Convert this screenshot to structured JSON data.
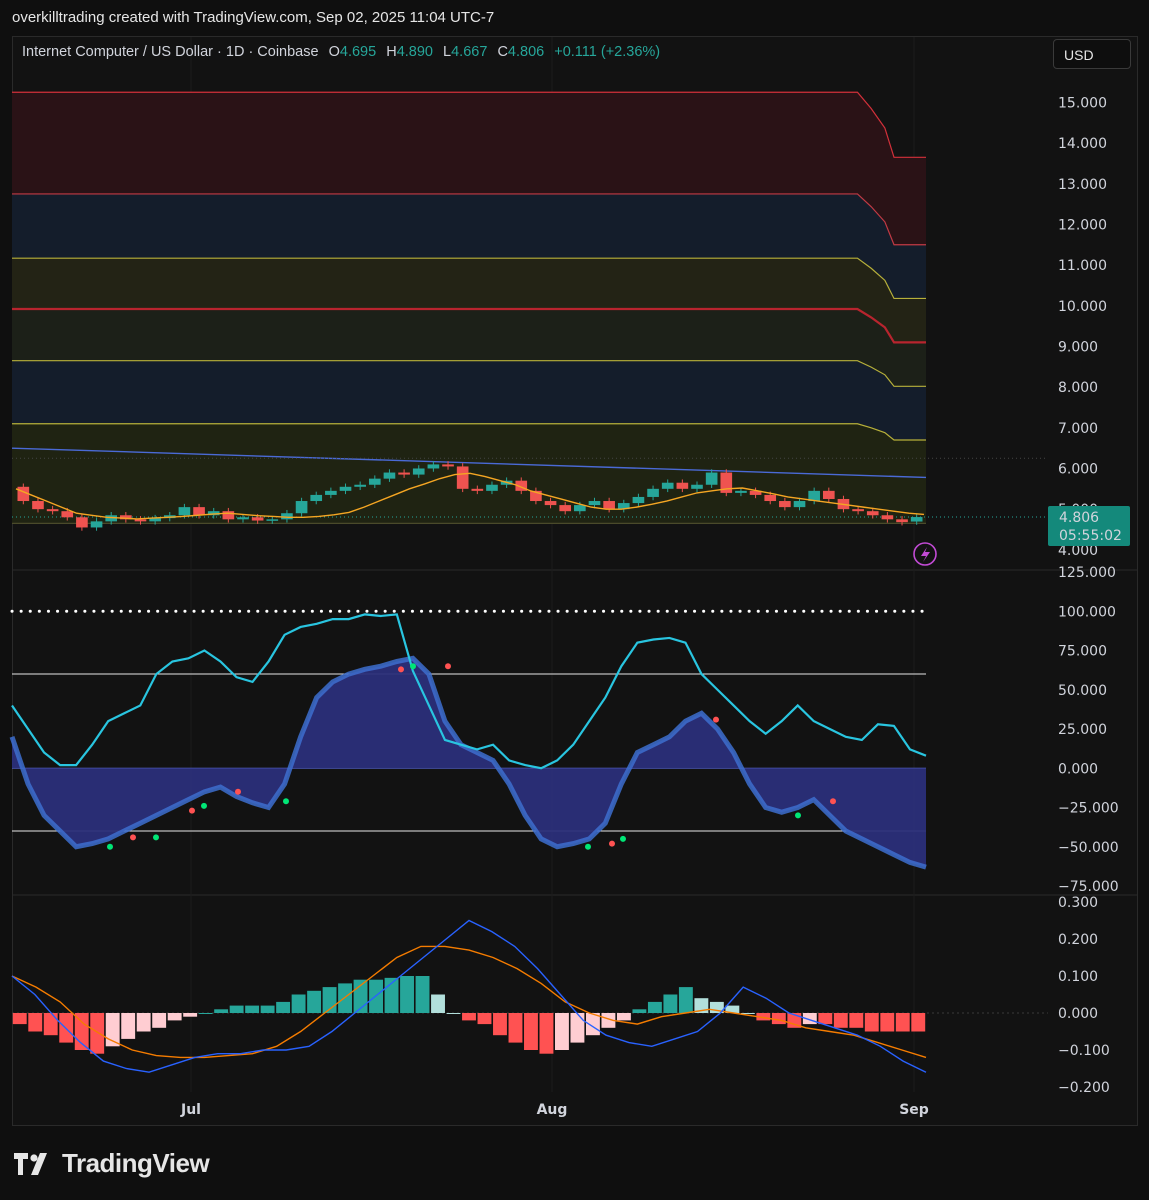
{
  "caption": "overkilltrading created with TradingView.com, Sep 02, 2025 11:04 UTC-7",
  "legend": {
    "symbol": "Internet Computer / US Dollar · 1D · Coinbase",
    "o_label": "O",
    "o_value": "4.695",
    "h_label": "H",
    "h_value": "4.890",
    "l_label": "L",
    "l_value": "4.667",
    "c_label": "C",
    "c_value": "4.806",
    "change": "+0.111 (+2.36%)"
  },
  "currency_button": "USD",
  "price_tag": {
    "price": "4.806",
    "countdown": "05:55:02"
  },
  "brand": "TradingView",
  "colors": {
    "up": "#26a69a",
    "down": "#ef5350",
    "accent_cyan": "#29c5e0",
    "histogram_up_strong": "#26a69a",
    "histogram_up_weak": "#b2dfdb",
    "histogram_down_strong": "#ff5252",
    "histogram_down_weak": "#ffcdd2"
  },
  "chart_data": [
    {
      "type": "candlestick",
      "pane": "price",
      "y_ticks": [
        "15.000",
        "14.000",
        "13.000",
        "12.000",
        "11.000",
        "10.000",
        "9.000",
        "8.000",
        "7.000",
        "6.000",
        "5.000",
        "4.000"
      ],
      "ylim": [
        3.75,
        15.6
      ],
      "x_ticks": [
        "Jul",
        "Aug",
        "Sep"
      ],
      "last_price": 4.806,
      "bands": [
        {
          "level_start": 15.25,
          "level_end": 13.65,
          "role": "top-red"
        },
        {
          "level_start": 12.75,
          "level_end": 11.5,
          "role": "red"
        },
        {
          "level_start": 11.17,
          "level_end": 10.18,
          "role": "yellow"
        },
        {
          "level_start": 9.92,
          "level_end": 9.1,
          "role": "red-center"
        },
        {
          "level_start": 8.65,
          "level_end": 8.02,
          "role": "yellow"
        },
        {
          "level_start": 7.1,
          "level_end": 6.7,
          "role": "yellow"
        },
        {
          "level_start": 4.65,
          "level_end": 4.65,
          "role": "bottom"
        }
      ],
      "slow_ma": {
        "start": 6.5,
        "end": 5.78
      },
      "fast_ma": [
        5.5,
        5.35,
        5.2,
        5.05,
        4.9,
        4.85,
        4.8,
        4.78,
        4.76,
        4.78,
        4.8,
        4.82,
        4.85,
        4.88,
        4.9,
        4.87,
        4.84,
        4.82,
        4.8,
        4.8,
        4.82,
        4.86,
        4.92,
        5.05,
        5.2,
        5.35,
        5.5,
        5.62,
        5.75,
        5.85,
        5.88,
        5.8,
        5.7,
        5.6,
        5.45,
        5.35,
        5.25,
        5.15,
        5.05,
        5.0,
        5.0,
        5.05,
        5.12,
        5.2,
        5.3,
        5.4,
        5.45,
        5.5,
        5.52,
        5.45,
        5.38,
        5.3,
        5.25,
        5.2,
        5.15,
        5.1,
        5.05,
        5.0,
        4.95,
        4.9,
        4.87
      ],
      "candles": [
        [
          5.55,
          5.2
        ],
        [
          5.2,
          5.0
        ],
        [
          5.0,
          4.95
        ],
        [
          4.95,
          4.8
        ],
        [
          4.8,
          4.55
        ],
        [
          4.55,
          4.7
        ],
        [
          4.7,
          4.85
        ],
        [
          4.85,
          4.75
        ],
        [
          4.75,
          4.7
        ],
        [
          4.7,
          4.78
        ],
        [
          4.78,
          4.85
        ],
        [
          4.85,
          5.05
        ],
        [
          5.05,
          4.85
        ],
        [
          4.85,
          4.95
        ],
        [
          4.95,
          4.75
        ],
        [
          4.75,
          4.8
        ],
        [
          4.8,
          4.72
        ],
        [
          4.72,
          4.75
        ],
        [
          4.75,
          4.9
        ],
        [
          4.9,
          5.2
        ],
        [
          5.2,
          5.35
        ],
        [
          5.35,
          5.45
        ],
        [
          5.45,
          5.55
        ],
        [
          5.55,
          5.6
        ],
        [
          5.6,
          5.75
        ],
        [
          5.75,
          5.9
        ],
        [
          5.9,
          5.85
        ],
        [
          5.85,
          6.0
        ],
        [
          6.0,
          6.1
        ],
        [
          6.1,
          6.05
        ],
        [
          6.05,
          5.5
        ],
        [
          5.5,
          5.45
        ],
        [
          5.45,
          5.6
        ],
        [
          5.6,
          5.7
        ],
        [
          5.7,
          5.45
        ],
        [
          5.45,
          5.2
        ],
        [
          5.2,
          5.1
        ],
        [
          5.1,
          4.95
        ],
        [
          4.95,
          5.1
        ],
        [
          5.1,
          5.2
        ],
        [
          5.2,
          5.0
        ],
        [
          5.0,
          5.15
        ],
        [
          5.15,
          5.3
        ],
        [
          5.3,
          5.5
        ],
        [
          5.5,
          5.65
        ],
        [
          5.65,
          5.5
        ],
        [
          5.5,
          5.6
        ],
        [
          5.6,
          5.9
        ],
        [
          5.9,
          5.4
        ],
        [
          5.4,
          5.45
        ],
        [
          5.45,
          5.35
        ],
        [
          5.35,
          5.2
        ],
        [
          5.2,
          5.05
        ],
        [
          5.05,
          5.2
        ],
        [
          5.2,
          5.45
        ],
        [
          5.45,
          5.25
        ],
        [
          5.25,
          5.0
        ],
        [
          5.0,
          4.95
        ],
        [
          4.95,
          4.85
        ],
        [
          4.85,
          4.75
        ],
        [
          4.75,
          4.68
        ],
        [
          4.695,
          4.806
        ]
      ]
    },
    {
      "type": "line",
      "pane": "oscillator",
      "y_ticks": [
        "125.000",
        "100.000",
        "75.000",
        "50.000",
        "25.000",
        "0.000",
        "−25.000",
        "−50.000",
        "−75.000"
      ],
      "ylim": [
        -75,
        125
      ],
      "levels": {
        "dotted": 100,
        "upper": 60,
        "zero": 0,
        "lower": -40
      },
      "series": [
        {
          "role": "fast-cyan",
          "values": [
            40,
            25,
            10,
            2,
            2,
            15,
            30,
            35,
            40,
            60,
            68,
            70,
            75,
            68,
            58,
            55,
            68,
            85,
            90,
            92,
            95,
            95,
            98,
            97,
            98,
            62,
            40,
            18,
            15,
            12,
            15,
            5,
            2,
            0,
            5,
            15,
            30,
            45,
            65,
            80,
            82,
            83,
            80,
            60,
            50,
            40,
            30,
            22,
            30,
            40,
            30,
            25,
            20,
            18,
            28,
            27,
            12,
            8
          ]
        },
        {
          "role": "slow-area",
          "values": [
            20,
            -10,
            -30,
            -40,
            -50,
            -48,
            -45,
            -40,
            -35,
            -30,
            -25,
            -20,
            -15,
            -12,
            -18,
            -22,
            -25,
            -10,
            20,
            45,
            55,
            60,
            63,
            65,
            68,
            70,
            60,
            30,
            15,
            10,
            5,
            -10,
            -30,
            -45,
            -50,
            -48,
            -45,
            -35,
            -10,
            10,
            15,
            20,
            30,
            35,
            25,
            10,
            -10,
            -25,
            -28,
            -25,
            -20,
            -30,
            -40,
            -45,
            -50,
            -55,
            -60,
            -63
          ]
        }
      ]
    },
    {
      "type": "bar+line",
      "pane": "macd",
      "y_ticks": [
        "0.300",
        "0.200",
        "0.100",
        "0.000",
        "−0.100",
        "−0.200"
      ],
      "ylim": [
        -0.2,
        0.3
      ],
      "histogram": [
        -0.03,
        -0.05,
        -0.06,
        -0.08,
        -0.1,
        -0.11,
        -0.09,
        -0.07,
        -0.05,
        -0.04,
        -0.02,
        -0.01,
        0.0,
        0.01,
        0.02,
        0.02,
        0.02,
        0.03,
        0.05,
        0.06,
        0.07,
        0.08,
        0.09,
        0.09,
        0.095,
        0.1,
        0.1,
        0.05,
        0.0,
        -0.02,
        -0.03,
        -0.06,
        -0.08,
        -0.1,
        -0.11,
        -0.1,
        -0.08,
        -0.06,
        -0.04,
        -0.02,
        0.01,
        0.03,
        0.05,
        0.07,
        0.04,
        0.03,
        0.02,
        0.0,
        -0.02,
        -0.03,
        -0.04,
        -0.03,
        -0.03,
        -0.04,
        -0.04,
        -0.05,
        -0.05,
        -0.05,
        -0.05
      ],
      "series": [
        {
          "role": "macd-blue",
          "values": [
            0.1,
            0.05,
            -0.02,
            -0.08,
            -0.13,
            -0.15,
            -0.16,
            -0.14,
            -0.12,
            -0.11,
            -0.11,
            -0.1,
            -0.1,
            -0.09,
            -0.05,
            0.0,
            0.05,
            0.1,
            0.15,
            0.2,
            0.25,
            0.22,
            0.18,
            0.12,
            0.05,
            -0.02,
            -0.06,
            -0.08,
            -0.09,
            -0.07,
            -0.05,
            0.0,
            0.07,
            0.04,
            0.0,
            -0.02,
            -0.04,
            -0.06,
            -0.09,
            -0.13,
            -0.16
          ]
        },
        {
          "role": "signal-orange",
          "values": [
            0.1,
            0.07,
            0.03,
            -0.03,
            -0.07,
            -0.1,
            -0.115,
            -0.12,
            -0.12,
            -0.115,
            -0.11,
            -0.09,
            -0.05,
            0.0,
            0.05,
            0.1,
            0.15,
            0.18,
            0.18,
            0.17,
            0.15,
            0.12,
            0.08,
            0.03,
            0.0,
            -0.02,
            -0.03,
            -0.01,
            0.0,
            0.01,
            0.0,
            -0.01,
            -0.02,
            -0.04,
            -0.05,
            -0.06,
            -0.08,
            -0.1,
            -0.12
          ]
        }
      ]
    }
  ]
}
